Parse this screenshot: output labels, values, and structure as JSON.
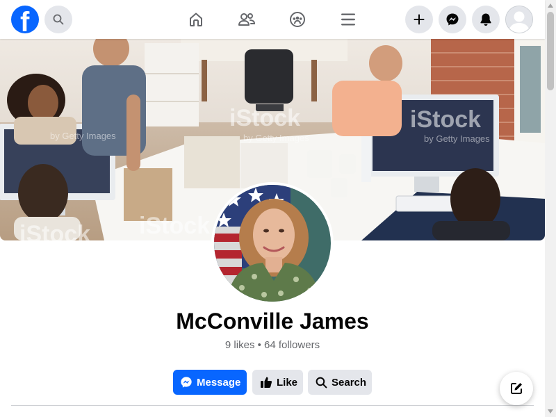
{
  "header": {
    "logo_letter": "f",
    "icons": {
      "search": "search-icon",
      "home": "home-icon",
      "friends": "friends-icon",
      "groups": "groups-icon",
      "menu": "menu-icon",
      "create": "plus-icon",
      "messenger": "messenger-icon",
      "notifications": "bell-icon",
      "account": "avatar-icon"
    }
  },
  "cover": {
    "watermark_brand": "iStock",
    "watermark_sub": "by Getty Images"
  },
  "profile": {
    "name": "McConville James",
    "stats": "9 likes • 64 followers"
  },
  "actions": {
    "message_label": "Message",
    "like_label": "Like",
    "search_label": "Search"
  },
  "colors": {
    "brand_blue": "#0866ff",
    "button_gray": "#e4e6eb",
    "text_primary": "#050505",
    "text_secondary": "#65676b"
  }
}
